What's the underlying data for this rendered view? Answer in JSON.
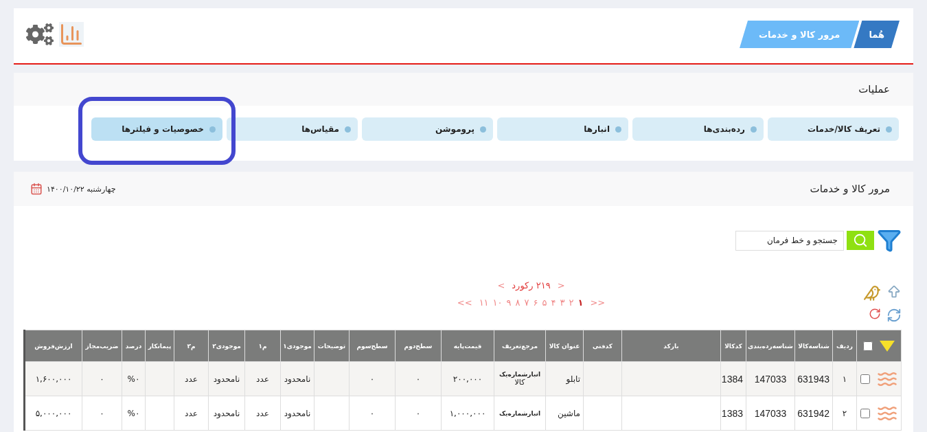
{
  "header": {
    "breadcrumb": [
      {
        "label": "هُما",
        "kind": "home"
      },
      {
        "label": "مرور کالا و خدمات",
        "kind": "page"
      }
    ]
  },
  "operations": {
    "title": "عملیات",
    "items": [
      {
        "label": "تعریف کالا/خدمات",
        "selected": false
      },
      {
        "label": "رده‌بندی‌ها",
        "selected": false
      },
      {
        "label": "انبارها",
        "selected": false
      },
      {
        "label": "پروموشن",
        "selected": false
      },
      {
        "label": "مقیاس‌ها",
        "selected": false
      },
      {
        "label": "خصوصیات و فیلترها",
        "selected": true
      }
    ]
  },
  "browse": {
    "title": "مرور کالا و خدمات",
    "date": "چهارشنبه ۱۴۰۰/۱۰/۲۲",
    "search": {
      "placeholder": "جستجو و خط فرمان"
    },
    "records": {
      "arrow_left": "<",
      "label": "۲۱۹ رکورد",
      "arrow_right": ">"
    },
    "pagination": {
      "arrow_left": "<<",
      "arrow_right": ">>",
      "pages": [
        {
          "label": "۱",
          "selected": true
        },
        {
          "label": "۲",
          "selected": false
        },
        {
          "label": "۳",
          "selected": false
        },
        {
          "label": "۴",
          "selected": false
        },
        {
          "label": "۵",
          "selected": false
        },
        {
          "label": "۶",
          "selected": false
        },
        {
          "label": "۷",
          "selected": false
        },
        {
          "label": "۸",
          "selected": false
        },
        {
          "label": "۹",
          "selected": false
        },
        {
          "label": "۱۰",
          "selected": false
        },
        {
          "label": "۱۱",
          "selected": false
        }
      ]
    },
    "table": {
      "select_all": {
        "checked": false
      },
      "columns": [
        "ردیف",
        "شناسه‌کالا",
        "شناسه‌رده‌بندی",
        "کدکالا",
        "بارکد",
        "کدفنی",
        "عنوان کالا",
        "مرجع‌تعریف",
        "قیمت‌پایه",
        "سطح‌دوم",
        "سطح‌سوم",
        "توضیحات",
        "موجودی۱",
        "م۱",
        "موجودی۲",
        "م۲",
        "پیمانکار",
        "درصد",
        "ضریب‌مجاز",
        "ارزش‌فروش"
      ],
      "rows": [
        {
          "checked": false,
          "cells": [
            "۱",
            "631943",
            "147033",
            "1384",
            null,
            null,
            "تابلو",
            {
              "title": "انبارشماره‌یک",
              "subtitle": "کالا"
            },
            "۲۰۰,۰۰۰",
            "۰",
            "۰",
            null,
            "نامحدود",
            "عدد",
            "نامحدود",
            "عدد",
            null,
            "%۰",
            "۰",
            "۱,۶۰۰,۰۰۰"
          ]
        },
        {
          "checked": false,
          "cells": [
            "۲",
            "631942",
            "147033",
            "1383",
            null,
            null,
            "ماشین",
            {
              "title": "انبارشماره‌یک"
            },
            "۱,۰۰۰,۰۰۰",
            "۰",
            "۰",
            null,
            "نامحدود",
            "عدد",
            "نامحدود",
            "عدد",
            null,
            "%۰",
            "۰",
            "۵,۰۰۰,۰۰۰"
          ]
        }
      ]
    }
  }
}
